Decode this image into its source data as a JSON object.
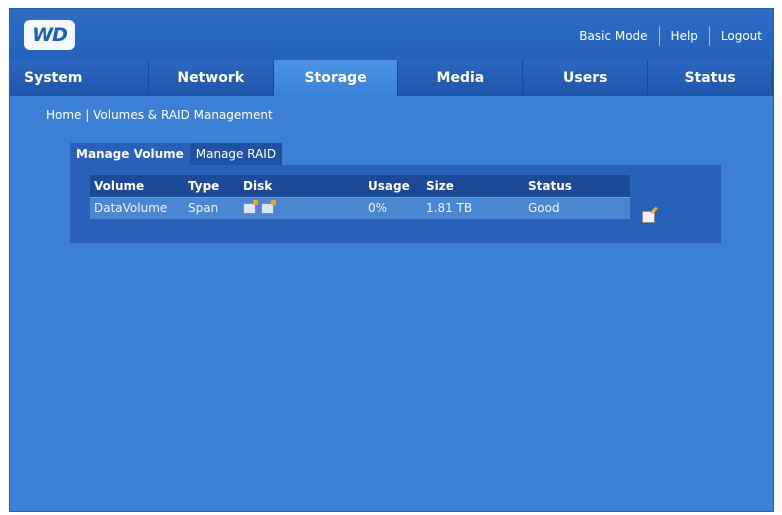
{
  "header": {
    "logo_text": "WD",
    "links": [
      "Basic Mode",
      "Help",
      "Logout"
    ]
  },
  "tabs": [
    {
      "label": "System"
    },
    {
      "label": "Network"
    },
    {
      "label": "Storage",
      "active": true
    },
    {
      "label": "Media"
    },
    {
      "label": "Users"
    },
    {
      "label": "Status"
    }
  ],
  "breadcrumb": "Home | Volumes & RAID Management",
  "subtabs": [
    {
      "label": "Manage Volume",
      "active": true
    },
    {
      "label": "Manage RAID"
    }
  ],
  "table": {
    "columns": [
      "Volume",
      "Type",
      "Disk",
      "Usage",
      "Size",
      "Status"
    ],
    "rows": [
      {
        "volume": "DataVolume",
        "type": "Span",
        "disk_icons": [
          "disk-icon",
          "disk-icon"
        ],
        "usage": "0%",
        "size": "1.81 TB",
        "status": "Good"
      }
    ]
  },
  "colors": {
    "background": "#3c80d6",
    "header": "#2563bb",
    "active_tab": "#4b93e4",
    "table_header": "#1a4a98"
  }
}
